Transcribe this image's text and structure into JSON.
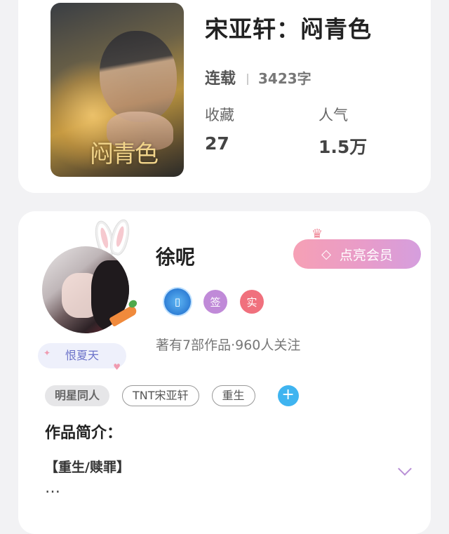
{
  "book": {
    "cover_title": "闷青色",
    "title": "宋亚轩：闷青色",
    "status": "连载",
    "word_count": "3423字",
    "favorites_label": "收藏",
    "favorites_value": "27",
    "popularity_label": "人气",
    "popularity_value": "1.5万"
  },
  "author": {
    "name": "徐呢",
    "nickname_badge": "恨夏天",
    "vip_button": "点亮会员",
    "badges": [
      {
        "icon": "phone-badge-icon",
        "label": ""
      },
      {
        "icon": "signed-badge-icon",
        "label": "签"
      },
      {
        "icon": "verified-badge-icon",
        "label": "实"
      }
    ],
    "meta": "著有7部作品·960人关注"
  },
  "tags": [
    "明星同人",
    "TNT宋亚轩",
    "重生"
  ],
  "intro": {
    "title": "作品简介：",
    "text": "【重生/赎罪】",
    "more": "…"
  },
  "colors": {
    "accent_pink": "#f6a0b5",
    "accent_purple": "#d59ede",
    "tag_add_blue": "#3fb4f0"
  }
}
